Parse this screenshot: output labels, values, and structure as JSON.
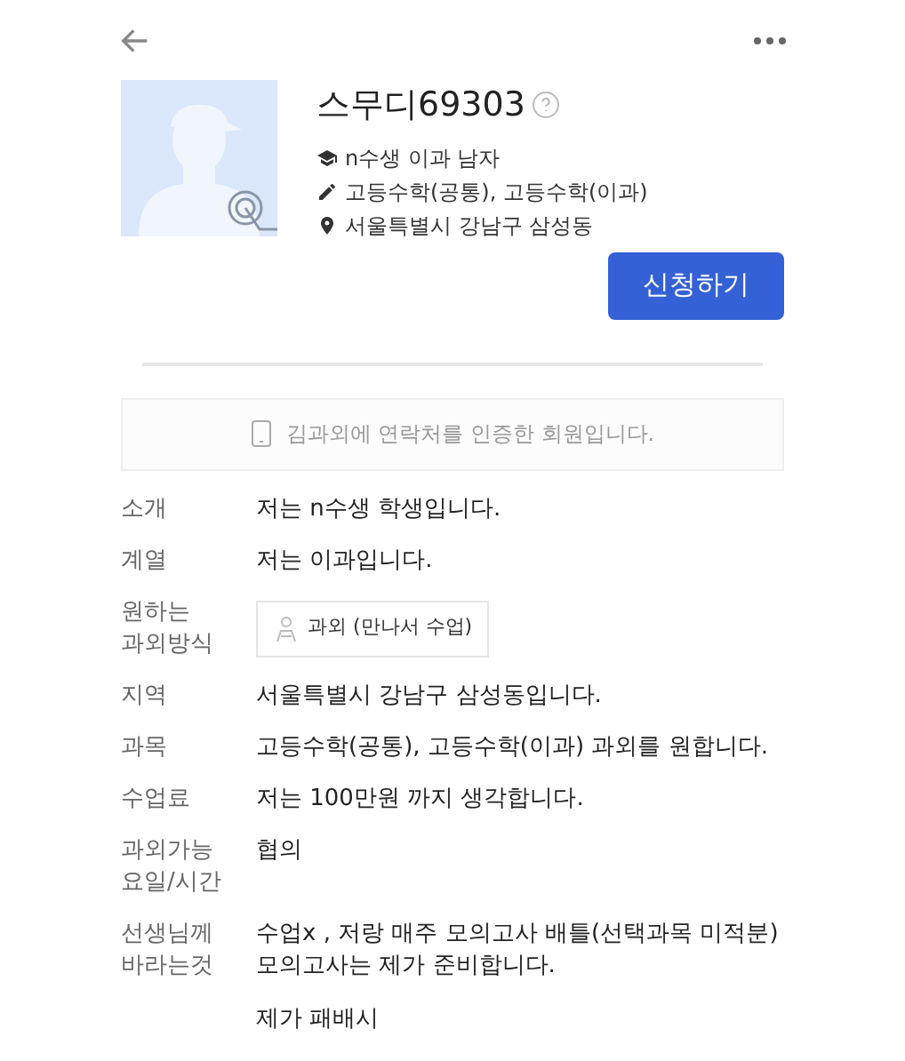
{
  "profile": {
    "name": "스무디69303",
    "details": [
      {
        "kind": "grade",
        "text": "n수생 이과 남자"
      },
      {
        "kind": "subject",
        "text": "고등수학(공통), 고등수학(이과)"
      },
      {
        "kind": "location",
        "text": "서울특별시 강남구 삼성동"
      }
    ],
    "apply_button": "신청하기"
  },
  "verified_notice": "김과외에 연락처를 인증한 회원입니다.",
  "fields": [
    {
      "kind": "text",
      "label": "소개",
      "lines": [
        "저는 n수생 학생입니다."
      ]
    },
    {
      "kind": "text",
      "label": "계열",
      "lines": [
        "저는 이과입니다."
      ]
    },
    {
      "kind": "chip",
      "label": "원하는 과외방식",
      "lines": [
        "과외 (만나서 수업)"
      ]
    },
    {
      "kind": "text",
      "label": "지역",
      "lines": [
        "서울특별시 강남구 삼성동입니다."
      ]
    },
    {
      "kind": "text",
      "label": "과목",
      "lines": [
        "고등수학(공통), 고등수학(이과) 과외를 원합니다."
      ]
    },
    {
      "kind": "text",
      "label": "수업료",
      "lines": [
        "저는 100만원 까지 생각합니다."
      ]
    },
    {
      "kind": "text",
      "label": "과외가능 요일/시간",
      "lines": [
        "협의"
      ]
    },
    {
      "kind": "text",
      "label": "선생님께 바라는것",
      "lines": [
        "수업x , 저랑 매주 모의고사 배틀(선택과목 미적분)",
        "모의고사는 제가 준비합니다."
      ],
      "extra_paragraph": "제가 패배시"
    }
  ]
}
